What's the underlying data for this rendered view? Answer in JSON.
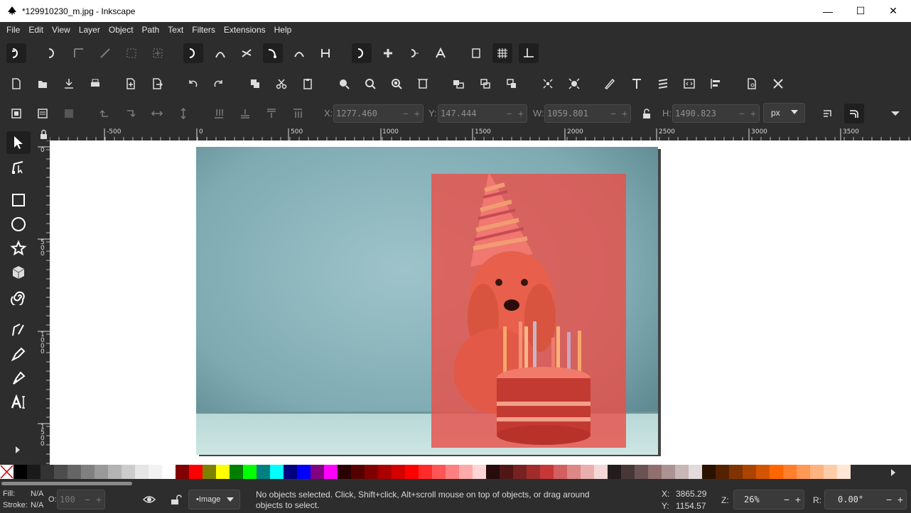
{
  "window": {
    "title": "*129910230_m.jpg - Inkscape",
    "minimize": "—",
    "maximize": "☐",
    "close": "✕"
  },
  "menu": [
    "File",
    "Edit",
    "View",
    "Layer",
    "Object",
    "Path",
    "Text",
    "Filters",
    "Extensions",
    "Help"
  ],
  "select_toolbar": {
    "x_label": "X:",
    "x_value": "1277.460",
    "y_label": "Y:",
    "y_value": "147.444",
    "w_label": "W:",
    "w_value": "1059.801",
    "h_label": "H:",
    "h_value": "1490.823",
    "unit": "px",
    "minus": "−",
    "plus": "+"
  },
  "ruler": {
    "h_labels": [
      "-500",
      "0",
      "500",
      "1000",
      "1500",
      "2000",
      "2500",
      "3000",
      "3500"
    ],
    "v_labels": [
      "0",
      "5 0 0",
      "1 0 0 0",
      "1 5 0 0"
    ]
  },
  "palette": {
    "colors": [
      "#000000",
      "#1a1a1a",
      "#333333",
      "#4d4d4d",
      "#666666",
      "#808080",
      "#999999",
      "#b3b3b3",
      "#cccccc",
      "#e6e6e6",
      "#f2f2f2",
      "#ffffff",
      "#800000",
      "#ff0000",
      "#808000",
      "#ffff00",
      "#008000",
      "#00ff00",
      "#008080",
      "#00ffff",
      "#000080",
      "#0000ff",
      "#800080",
      "#ff00ff",
      "#2b0000",
      "#550000",
      "#800000",
      "#aa0000",
      "#d40000",
      "#ff0000",
      "#ff2a2a",
      "#ff5555",
      "#ff8080",
      "#ffaaaa",
      "#ffd5d5",
      "#280b0b",
      "#501616",
      "#782121",
      "#a02c2c",
      "#c83737",
      "#d35f5f",
      "#de8787",
      "#e9afaf",
      "#f4d7d7",
      "#241c1c",
      "#483737",
      "#6c5353",
      "#916f6f",
      "#ac9393",
      "#c8b7b7",
      "#e3dbdb",
      "#2b1100",
      "#552200",
      "#803300",
      "#aa4400",
      "#d45500",
      "#ff6600",
      "#ff7f2a",
      "#ff9955",
      "#ffb380",
      "#ffccaa",
      "#ffe6d5"
    ]
  },
  "status": {
    "fill_label": "Fill:",
    "fill_value": "N/A",
    "stroke_label": "Stroke:",
    "stroke_value": "N/A",
    "opacity_label": "O:",
    "opacity_value": "100",
    "layer": "•Image",
    "message_line1": "No objects selected. Click, Shift+click, Alt+scroll mouse on top of objects, or drag around",
    "message_line2": "objects to select.",
    "x_label": "X:",
    "x_value": "3865.29",
    "y_label": "Y:",
    "y_value": "1154.57",
    "zoom_label": "Z:",
    "zoom_value": "26%",
    "rotate_label": "R:",
    "rotate_value": "0.00°"
  },
  "colors": {
    "selection_overlay": "#e8504a",
    "photo_bg": "#8fb7bf",
    "ui_bg": "#2d2d2d"
  }
}
